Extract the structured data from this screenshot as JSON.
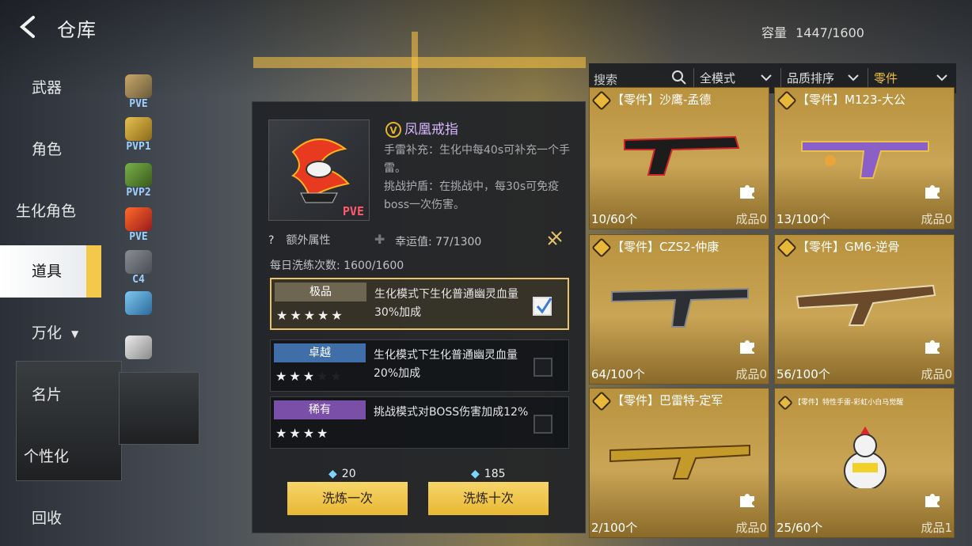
{
  "header": {
    "title": "仓库",
    "capacity_label": "容量",
    "capacity_value": "1447/1600"
  },
  "nav": {
    "items": [
      {
        "label": "武器"
      },
      {
        "label": "角色"
      },
      {
        "label": "生化角色"
      },
      {
        "label": "道具",
        "active": true
      },
      {
        "label": "万化",
        "caret": "▼"
      },
      {
        "label": "名片"
      },
      {
        "label": "个性化"
      },
      {
        "label": "回收"
      }
    ]
  },
  "strip": [
    {
      "label": "PVE"
    },
    {
      "label": "PVP1"
    },
    {
      "label": "PVP2"
    },
    {
      "label": "PVE"
    },
    {
      "label": "C4"
    },
    {
      "label": ""
    },
    {
      "label": ""
    }
  ],
  "detail": {
    "tag": "PVE",
    "badge": "V",
    "name": "凤凰戒指",
    "desc1": "手雷补充：生化中每40s可补充一个手雷。",
    "desc2": "挑战护盾：在挑战中，每30s可免疫boss一次伤害。",
    "extra_q": "?",
    "extra_label": "额外属性",
    "luck_label": "幸运值:",
    "luck_value": "77/1300",
    "daily_label": "每日洗练次数:",
    "daily_value": "1600/1600",
    "options": [
      {
        "tier": "极品",
        "tier_color": "#6e6650",
        "stars": "★★★★★",
        "dim": "",
        "text": "生化模式下生化普通幽灵血量30%加成",
        "checked": true
      },
      {
        "tier": "卓越",
        "tier_color": "#3f6ea8",
        "stars": "★★★",
        "dim": "★★",
        "text": "生化模式下生化普通幽灵血量20%加成",
        "checked": false
      },
      {
        "tier": "稀有",
        "tier_color": "#7a4fa8",
        "stars": "★★★★",
        "dim": "",
        "text": "挑战模式对BOSS伤害加成12%",
        "checked": false
      }
    ],
    "cost1": "20",
    "cost10": "185",
    "btn1": "洗炼一次",
    "btn10": "洗炼十次"
  },
  "filters": {
    "search_placeholder": "搜索",
    "mode": "全模式",
    "sort": "品质排序",
    "category": "零件",
    "category_color": "#f0c040"
  },
  "cards": [
    {
      "name": "【零件】沙鹰-孟德",
      "count": "10/60个",
      "done": "成品0",
      "gun_color": "#c9242a"
    },
    {
      "name": "【零件】M123-大公",
      "count": "13/100个",
      "done": "成品0",
      "gun_color": "#8a5fc8"
    },
    {
      "name": "【零件】CZS2-仲康",
      "count": "64/100个",
      "done": "成品0",
      "gun_color": "#3b3f46"
    },
    {
      "name": "【零件】GM6-逆骨",
      "count": "56/100个",
      "done": "成品0",
      "gun_color": "#6a4a2a"
    },
    {
      "name": "【零件】巴雷特-定军",
      "count": "2/100个",
      "done": "成品0",
      "gun_color": "#c49a2a"
    },
    {
      "name": "【零件】特性手雷-彩虹小白马觉醒",
      "count": "25/60个",
      "done": "成品1",
      "gun_color": "#e8e8e8"
    }
  ]
}
